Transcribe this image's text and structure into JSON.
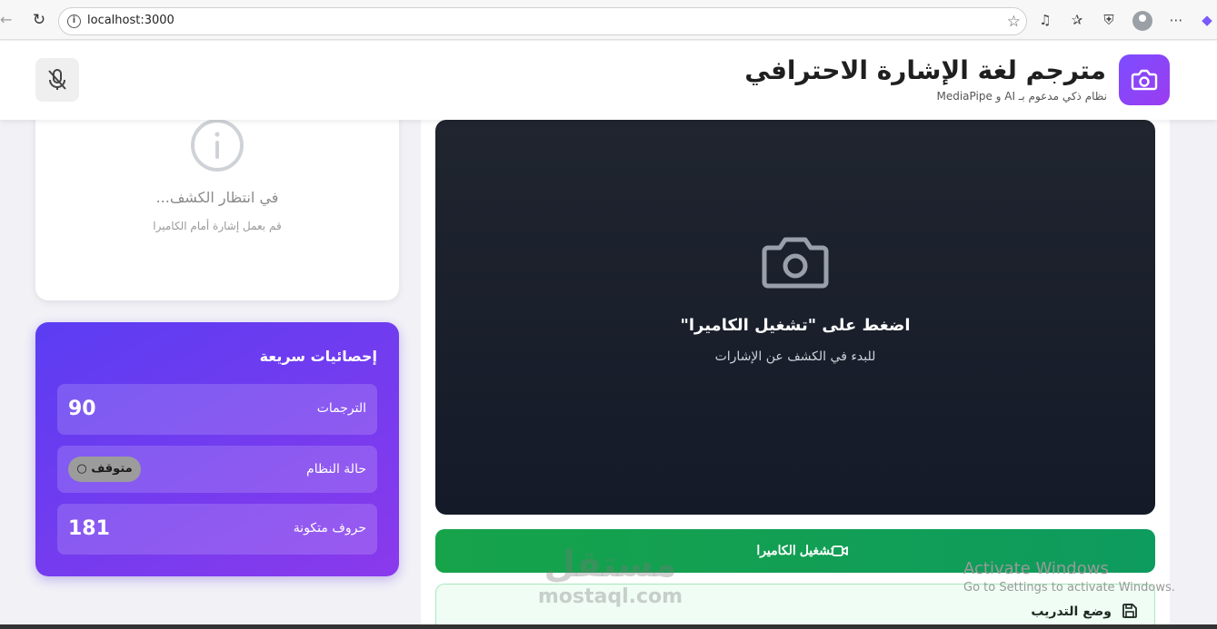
{
  "browser": {
    "url": "localhost:3000"
  },
  "header": {
    "title": "مترجم لغة الإشارة الاحترافي",
    "subtitle": "نظام ذكي مدعوم بـ AI و MediaPipe"
  },
  "detection": {
    "waiting_text": "في انتظار الكشف...",
    "hint_text": "قم بعمل إشارة أمام الكاميرا"
  },
  "stats": {
    "title": "إحصائيات سريعة",
    "rows": [
      {
        "label": "الترجمات",
        "value": "90"
      },
      {
        "label": "حالة النظام",
        "status": "متوقف"
      },
      {
        "label": "حروف متكونة",
        "value": "181"
      }
    ]
  },
  "camera": {
    "prompt": "اضغط على \"تشغيل الكاميرا\"",
    "sub_prompt": "للبدء في الكشف عن الإشارات",
    "start_button": "تشغيل الكاميرا"
  },
  "training": {
    "label": "وضع التدريب"
  },
  "watermark": {
    "arabic": "مستقل",
    "latin": "mostaql.com"
  },
  "activation": {
    "title": "Activate Windows",
    "subtitle": "Go to Settings to activate Windows."
  },
  "colors": {
    "brand_purple": "#7c4dff",
    "stats_gradient_start": "#5b3df2",
    "stats_gradient_end": "#8a3aec",
    "start_button_green": "#16a34a",
    "video_background": "#1a1f2c"
  }
}
